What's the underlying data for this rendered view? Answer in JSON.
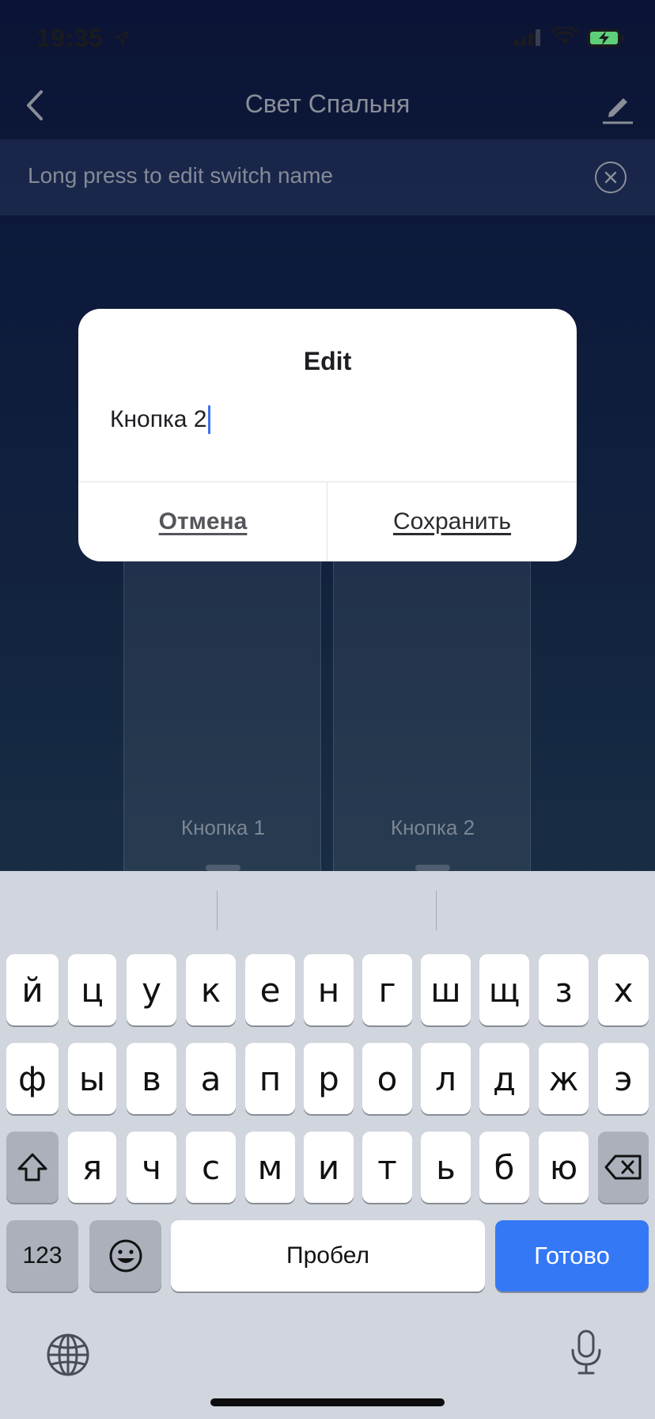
{
  "status_bar": {
    "time": "19:35",
    "icons": [
      "location-arrow-icon",
      "signal-icon",
      "wifi-icon",
      "battery-charging-icon"
    ]
  },
  "nav": {
    "title": "Свет Спальня",
    "back_icon": "chevron-left-icon",
    "edit_icon": "pencil-icon"
  },
  "hint": {
    "text": "Long press to edit switch name",
    "close_icon": "close-circle-icon"
  },
  "switches": [
    {
      "label": "Кнопка 1"
    },
    {
      "label": "Кнопка 2"
    }
  ],
  "dialog": {
    "title": "Edit",
    "input_value": "Кнопка 2",
    "cancel_label": "Отмена",
    "save_label": "Сохранить"
  },
  "keyboard": {
    "row1": [
      "й",
      "ц",
      "у",
      "к",
      "е",
      "н",
      "г",
      "ш",
      "щ",
      "з",
      "х"
    ],
    "row2": [
      "ф",
      "ы",
      "в",
      "а",
      "п",
      "р",
      "о",
      "л",
      "д",
      "ж",
      "э"
    ],
    "row3": [
      "я",
      "ч",
      "с",
      "м",
      "и",
      "т",
      "ь",
      "б",
      "ю"
    ],
    "numbers_label": "123",
    "space_label": "Пробел",
    "done_label": "Готово",
    "accent_color": "#3478f6"
  }
}
